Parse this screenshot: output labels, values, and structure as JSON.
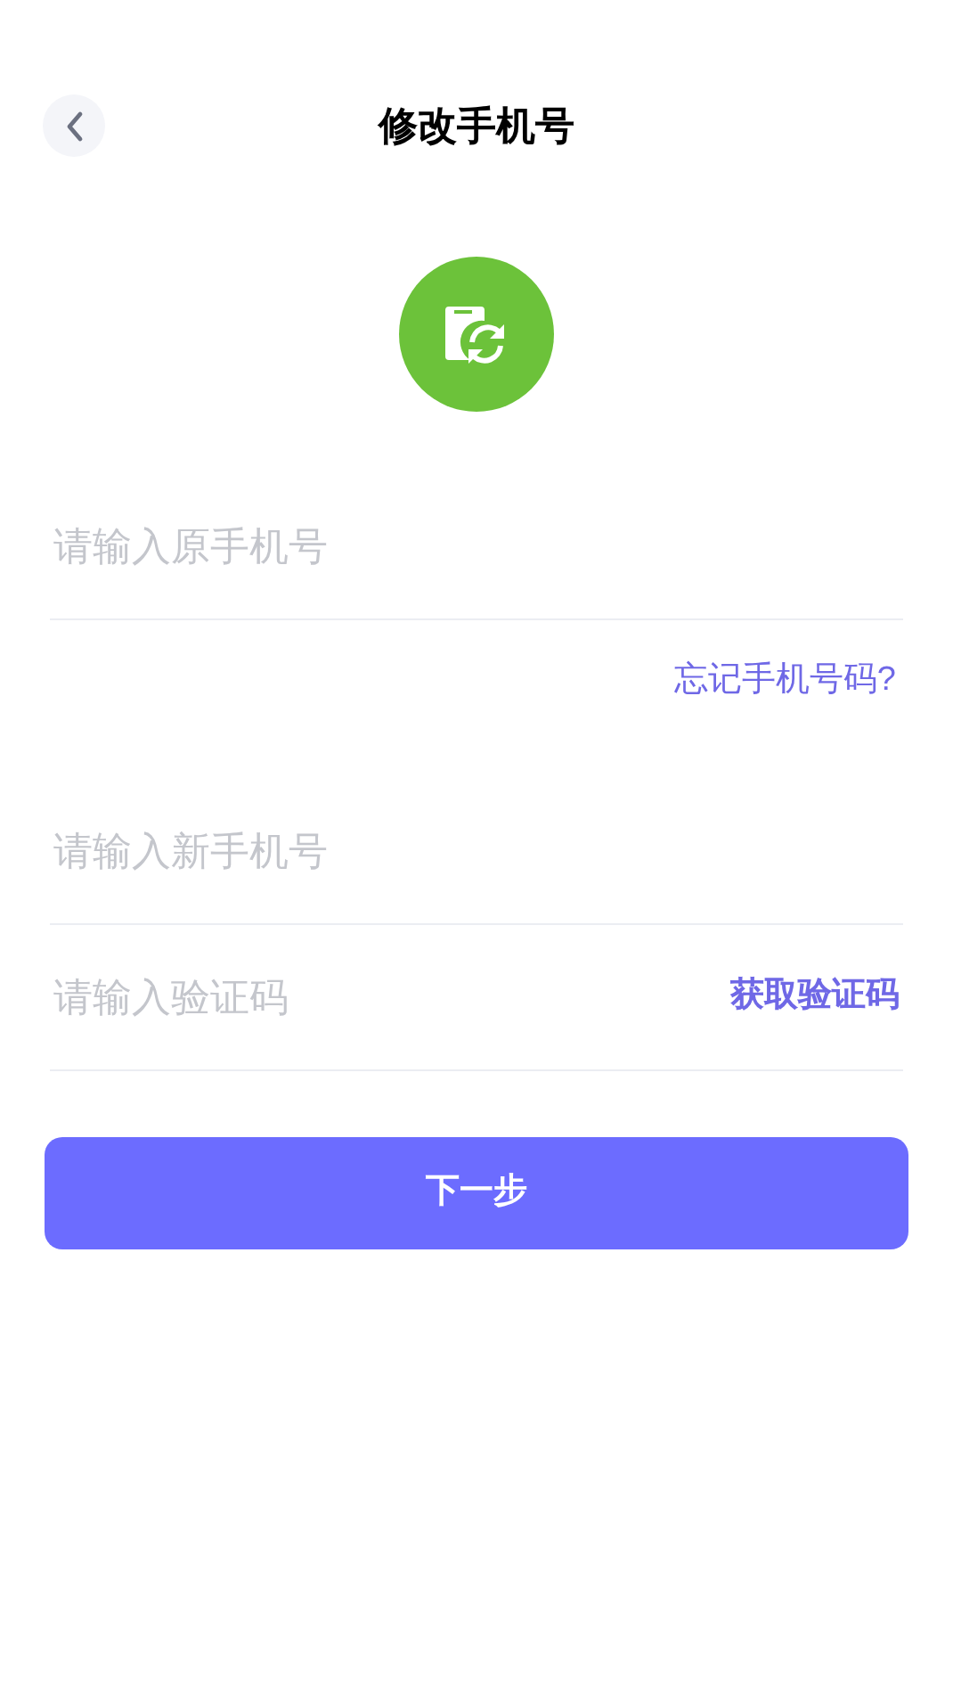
{
  "header": {
    "title": "修改手机号"
  },
  "fields": [
    {
      "placeholder": "请输入原手机号"
    },
    {
      "placeholder": "请输入新手机号"
    },
    {
      "placeholder": "请输入验证码",
      "action": "获取验证码"
    }
  ],
  "forgot_link": "忘记手机号码?",
  "next_button": "下一步"
}
